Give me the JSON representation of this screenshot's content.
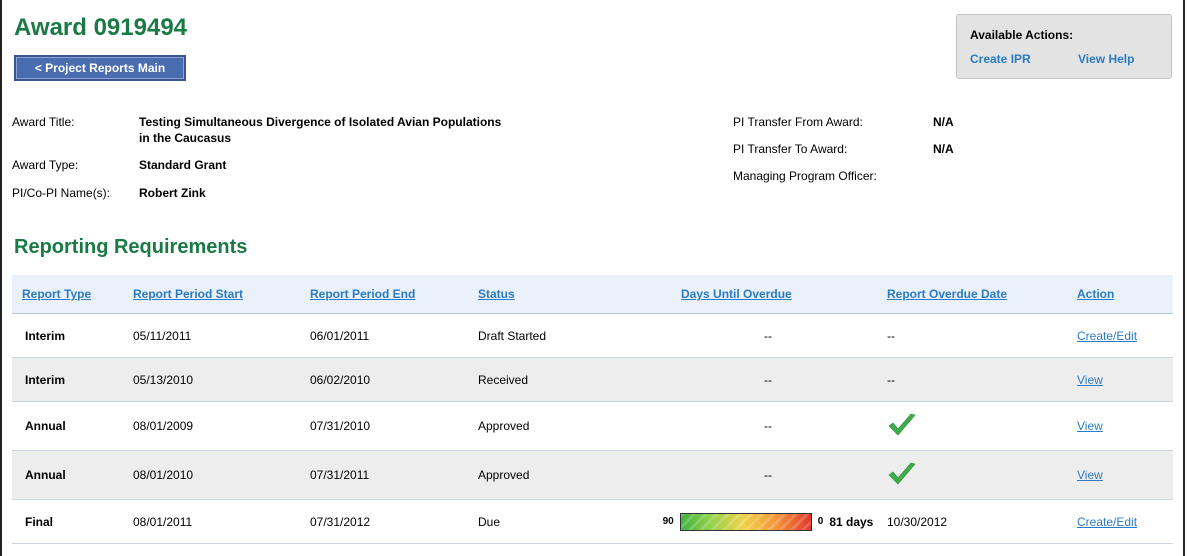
{
  "header": {
    "award_title": "Award 0919494",
    "back_button": "< Project Reports Main"
  },
  "available_actions": {
    "title": "Available Actions:",
    "links": [
      "Create IPR",
      "View Help"
    ]
  },
  "award_info": {
    "left": [
      {
        "label": "Award Title:",
        "value": "Testing Simultaneous Divergence of Isolated Avian Populations",
        "value_line2": "in the Caucasus"
      },
      {
        "label": "Award Type:",
        "value": "Standard Grant"
      },
      {
        "label": "PI/Co-PI Name(s):",
        "value": "Robert Zink"
      }
    ],
    "right": [
      {
        "label": "PI Transfer From Award:",
        "value": "N/A"
      },
      {
        "label": "PI Transfer To Award:",
        "value": "N/A"
      },
      {
        "label": "Managing Program Officer:",
        "value": ""
      }
    ]
  },
  "reporting": {
    "title": "Reporting Requirements",
    "columns": [
      "Report Type",
      "Report Period Start",
      "Report Period End",
      "Status",
      "Days Until Overdue",
      "Report Overdue Date",
      "Action"
    ],
    "rows": [
      {
        "type": "Interim",
        "start": "05/11/2011",
        "end": "06/01/2011",
        "status": "Draft Started",
        "days": "--",
        "overdue": "--",
        "action": "Create/Edit"
      },
      {
        "type": "Interim",
        "start": "05/13/2010",
        "end": "06/02/2010",
        "status": "Received",
        "days": "--",
        "overdue": "--",
        "action": "View"
      },
      {
        "type": "Annual",
        "start": "08/01/2009",
        "end": "07/31/2010",
        "status": "Approved",
        "days": "--",
        "overdue_icon": "checkmark-icon",
        "action": "View"
      },
      {
        "type": "Annual",
        "start": "08/01/2010",
        "end": "07/31/2011",
        "status": "Approved",
        "days": "--",
        "overdue_icon": "checkmark-icon",
        "action": "View"
      },
      {
        "type": "Final",
        "start": "08/01/2011",
        "end": "07/31/2012",
        "status": "Due",
        "gauge": {
          "min": "90",
          "max": "0",
          "label": "81 days",
          "fill_fraction": 0.1
        },
        "overdue": "10/30/2012",
        "action": "Create/Edit"
      }
    ]
  },
  "colors": {
    "green_heading": "#1a7a45",
    "link_blue": "#2a7bc4",
    "button_blue": "#4a6db0",
    "header_bg": "#eaf1fa",
    "alt_row": "#ededed",
    "check_green": "#3fae4a"
  }
}
